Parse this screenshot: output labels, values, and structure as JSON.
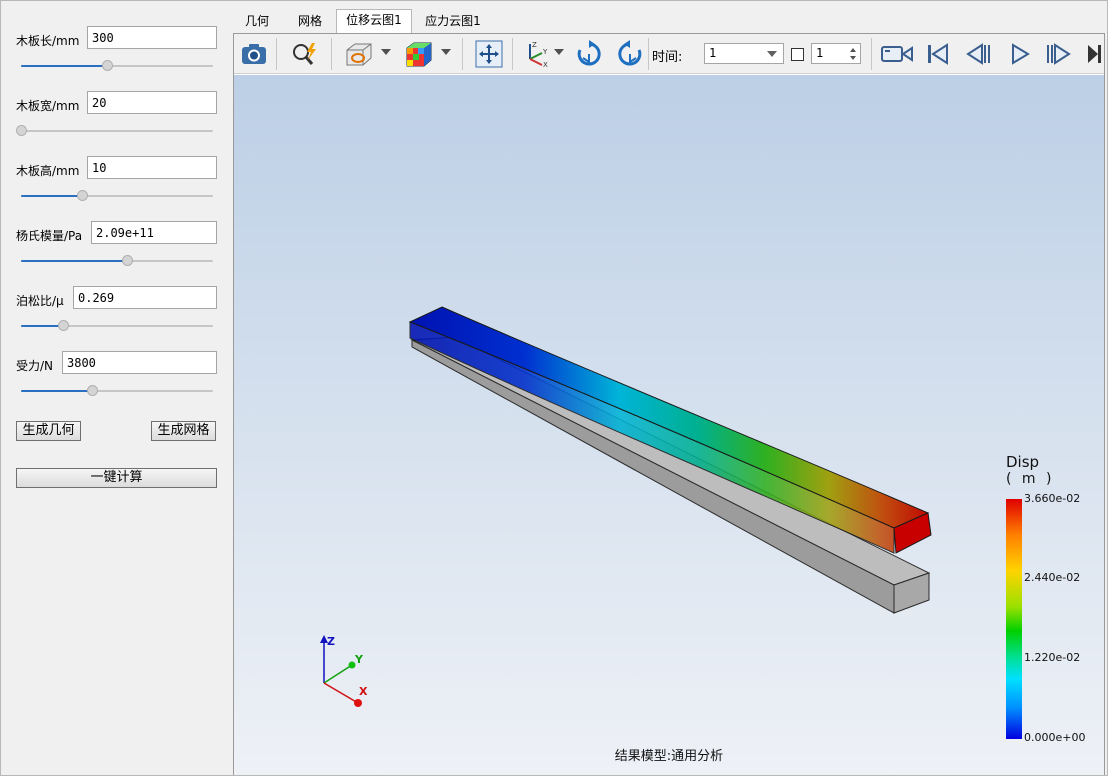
{
  "params": [
    {
      "label": "木板长/mm",
      "value": "300",
      "slider": 0.45
    },
    {
      "label": "木板宽/mm",
      "value": "20",
      "slider": 0.0
    },
    {
      "label": "木板高/mm",
      "value": "10",
      "slider": 0.32
    },
    {
      "label": "杨氏模量/Pa",
      "value": "2.09e+11",
      "slider": 0.55
    },
    {
      "label": "泊松比/μ",
      "value": "0.269",
      "slider": 0.22
    },
    {
      "label": "受力/N",
      "value": "3800",
      "slider": 0.37
    }
  ],
  "buttons": {
    "gen_geometry": "生成几何",
    "gen_mesh": "生成网格",
    "compute": "一键计算"
  },
  "tabs": [
    "几何",
    "网格",
    "位移云图1",
    "应力云图1"
  ],
  "active_tab": 2,
  "toolbar": {
    "icons": [
      "camera-icon",
      "zoom-icon",
      "view-cube-icon",
      "color-cube-icon",
      "fit-view-icon",
      "axes-icon",
      "rotate-cw-icon",
      "rotate-ccw-icon",
      "record-icon",
      "first-frame-icon",
      "prev-frame-icon",
      "play-icon",
      "next-frame-icon",
      "last-frame-icon"
    ],
    "time_label": "时间:",
    "time_value": "1",
    "step_value": "1"
  },
  "legend": {
    "title": "Disp",
    "unit": "( m )",
    "ticks": [
      "3.660e-02",
      "2.440e-02",
      "1.220e-02",
      "0.000e+00"
    ],
    "colors": [
      "#0000e0",
      "#00e0ff",
      "#00d000",
      "#ffd400",
      "#e00000"
    ]
  },
  "triad": {
    "z": "Z",
    "y": "Y",
    "x": "X"
  },
  "status": "结果模型:通用分析"
}
